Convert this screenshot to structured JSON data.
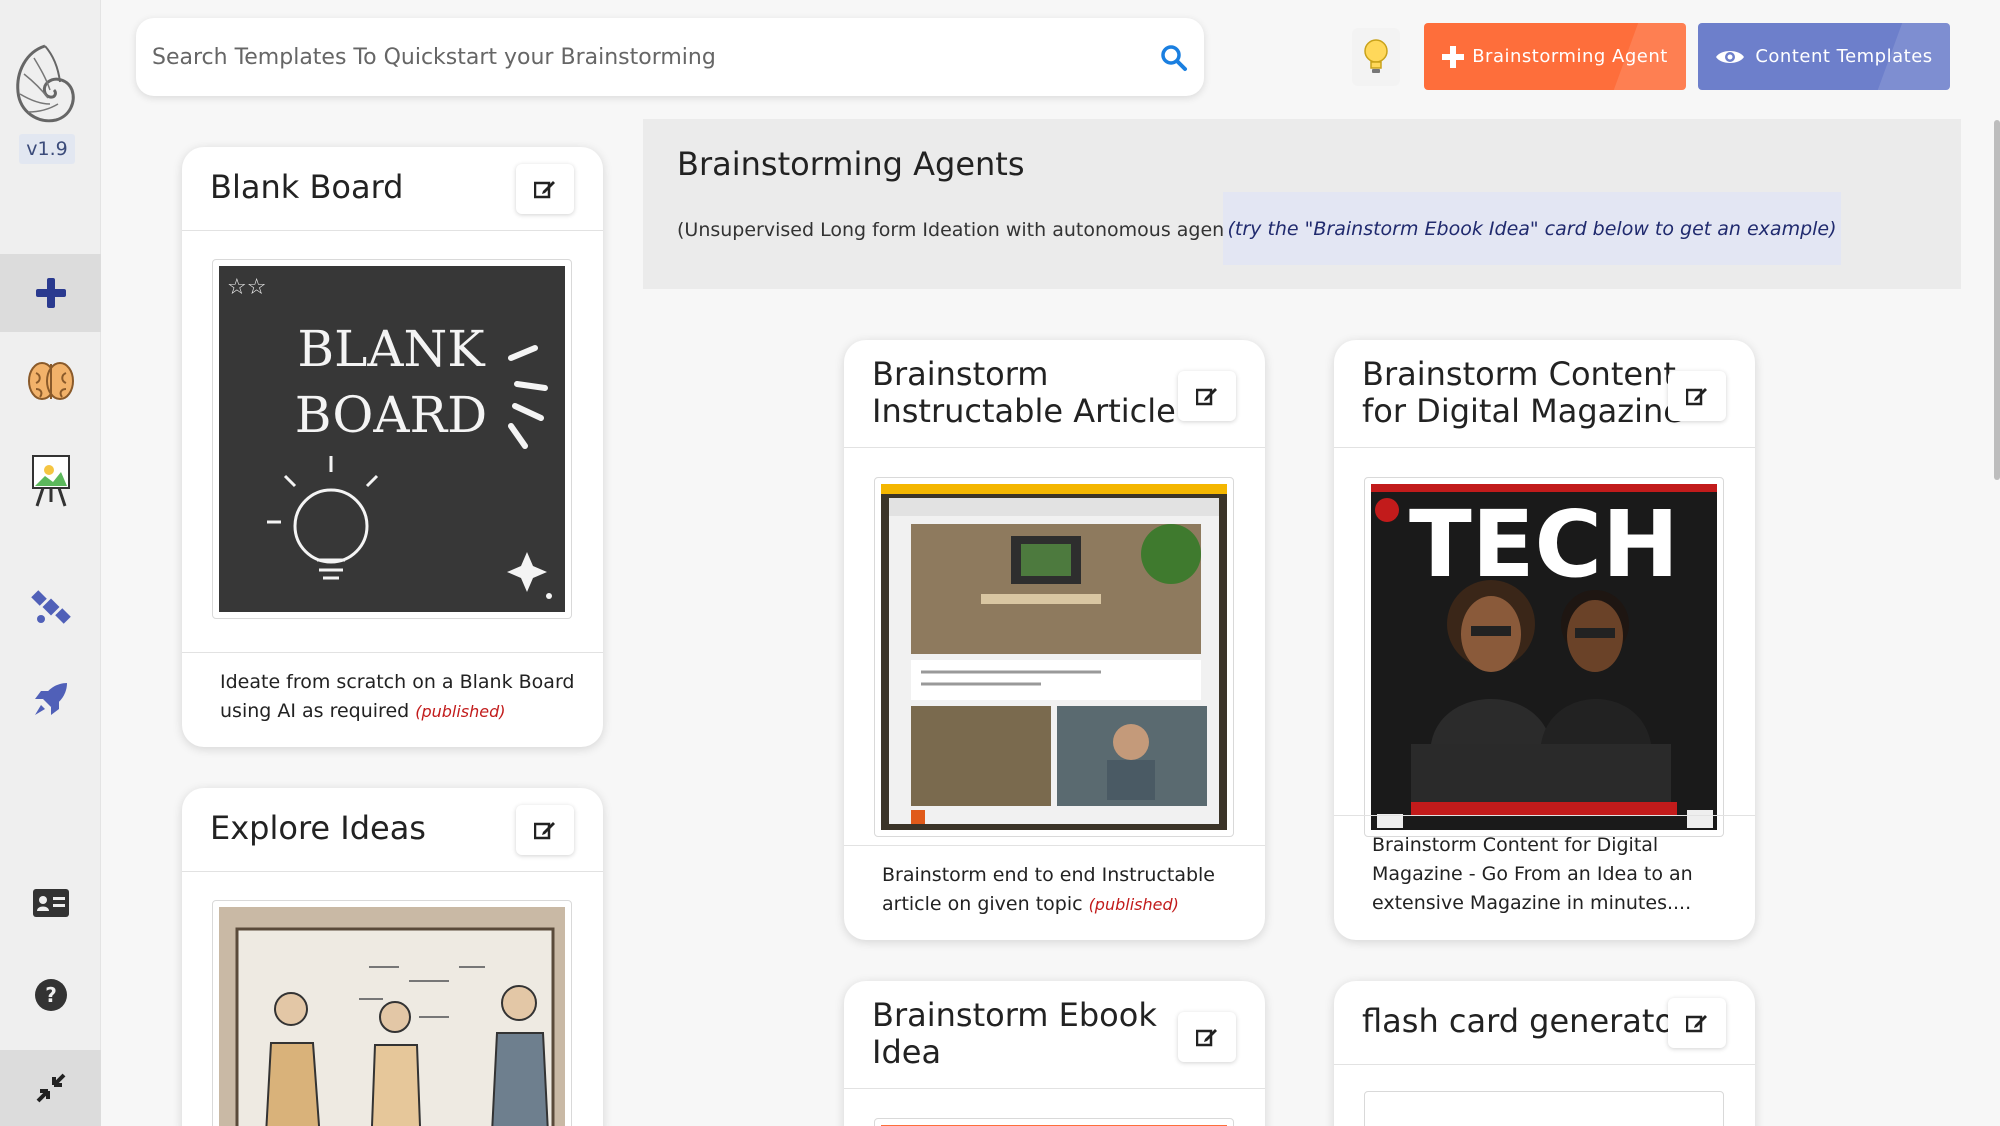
{
  "app": {
    "version": "v1.9"
  },
  "sidebar": {
    "items": [
      {
        "icon": "plus-icon",
        "active": true
      },
      {
        "icon": "brain-icon"
      },
      {
        "icon": "easel-icon"
      },
      {
        "icon": "satellite-icon"
      },
      {
        "icon": "rocket-icon"
      },
      {
        "icon": "id-card-icon"
      },
      {
        "icon": "help-icon"
      },
      {
        "icon": "collapse-icon"
      }
    ]
  },
  "search": {
    "placeholder": "Search Templates To Quickstart your Brainstorming"
  },
  "toolbar": {
    "bulb_icon": "lightbulb-icon",
    "agent_button": "Brainstorming Agent",
    "templates_button": "Content Templates"
  },
  "agents": {
    "heading": "Brainstorming Agents",
    "subtitle": "(Unsupervised Long form Ideation with autonomous agents)",
    "hint": "(try the \"Brainstorm Ebook Idea\" card below to get an example)"
  },
  "cards": {
    "blank": {
      "title": "Blank Board",
      "image_text_1": "BLANK",
      "image_text_2": "BOARD",
      "desc": "Ideate from scratch on a Blank Board using AI as required",
      "status": "(published)"
    },
    "explore": {
      "title": "Explore Ideas"
    },
    "instructable": {
      "title_1": "Brainstorm",
      "title_2": "Instructable Article",
      "desc": "Brainstorm end to end Instructable article on given topic",
      "status": "(published)"
    },
    "magazine": {
      "title_1": "Brainstorm Content",
      "title_2": "for Digital Magazine",
      "image_text": "TECH",
      "desc": "Brainstorm Content for Digital Magazine - Go From an Idea to an extensive Magazine in minutes...."
    },
    "ebook": {
      "title_1": "Brainstorm Ebook",
      "title_2": "Idea"
    },
    "flash": {
      "title": "flash card generator"
    }
  },
  "colors": {
    "accent_orange": "#fe6e3b",
    "accent_blue": "#6d7fcb",
    "nav_blue": "#2a3a8f",
    "published_red": "#c21b1b"
  }
}
